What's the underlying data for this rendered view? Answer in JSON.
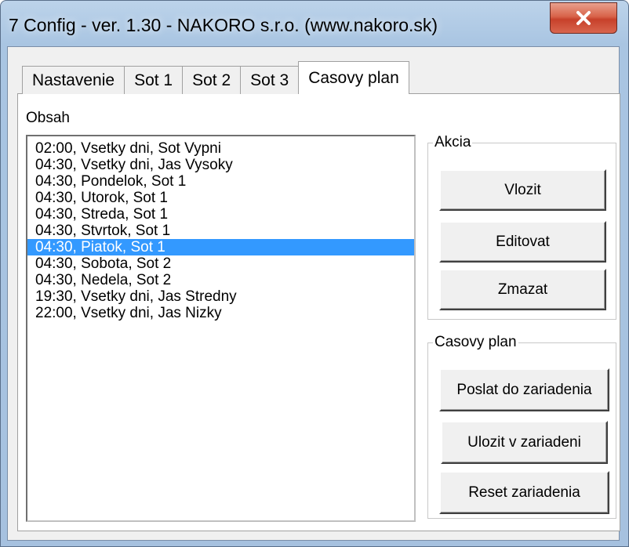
{
  "window": {
    "title": "7 Config - ver. 1.30 - NAKORO s.r.o. (www.nakoro.sk)",
    "close_icon": "close-icon"
  },
  "tabs": [
    {
      "label": "Nastavenie",
      "active": false
    },
    {
      "label": "Sot 1",
      "active": false
    },
    {
      "label": "Sot 2",
      "active": false
    },
    {
      "label": "Sot 3",
      "active": false
    },
    {
      "label": "Casovy plan",
      "active": true
    }
  ],
  "content": {
    "obsah_label": "Obsah",
    "list_items": [
      "02:00, Vsetky dni, Sot Vypni",
      "04:30, Vsetky dni, Jas Vysoky",
      "04:30, Pondelok, Sot 1",
      "04:30, Utorok, Sot 1",
      "04:30, Streda, Sot 1",
      "04:30, Stvrtok, Sot 1",
      "04:30, Piatok, Sot 1",
      "04:30, Sobota, Sot 2",
      "04:30, Nedela, Sot 2",
      "19:30, Vsetky dni, Jas Stredny",
      "22:00, Vsetky dni, Jas Nizky"
    ],
    "selected_index": 6
  },
  "akcia": {
    "label": "Akcia",
    "vlozit": "Vlozit",
    "editovat": "Editovat",
    "zmazat": "Zmazat"
  },
  "casovy_plan": {
    "label": "Casovy plan",
    "poslat": "Poslat do zariadenia",
    "ulozit": "Ulozit v zariadeni",
    "reset": "Reset zariadenia"
  },
  "colors": {
    "selection": "#3399ff",
    "close_button": "#c7412a"
  }
}
